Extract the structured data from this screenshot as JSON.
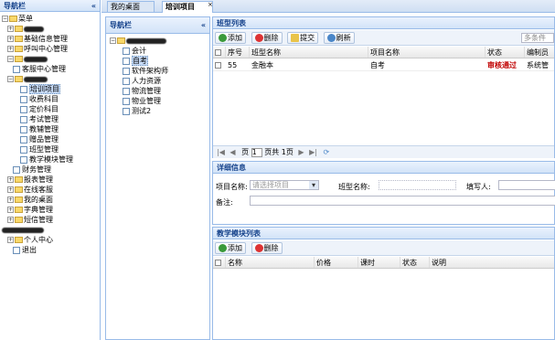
{
  "nav": {
    "title": "导航栏",
    "collapse": "«"
  },
  "tree": [
    {
      "label": "菜单",
      "level": 0,
      "pm": "−",
      "type": "folder"
    },
    {
      "label": "",
      "level": 1,
      "pm": "+",
      "type": "folder",
      "blur": 22
    },
    {
      "label": "基础信息管理",
      "level": 1,
      "pm": "+",
      "type": "folder"
    },
    {
      "label": "呼叫中心管理",
      "level": 1,
      "pm": "+",
      "type": "folder"
    },
    {
      "label": "",
      "level": 1,
      "pm": "−",
      "type": "folder",
      "blur": 26
    },
    {
      "label": "客服中心管理",
      "level": 2,
      "pm": "",
      "type": "leaf"
    },
    {
      "label": "",
      "level": 1,
      "pm": "−",
      "type": "folder",
      "blur": 26
    },
    {
      "label": "培训项目",
      "level": 3,
      "pm": "",
      "type": "leaf",
      "sel": true
    },
    {
      "label": "收费科目",
      "level": 3,
      "pm": "",
      "type": "leaf"
    },
    {
      "label": "定价科目",
      "level": 3,
      "pm": "",
      "type": "leaf"
    },
    {
      "label": "考试管理",
      "level": 3,
      "pm": "",
      "type": "leaf"
    },
    {
      "label": "教辅管理",
      "level": 3,
      "pm": "",
      "type": "leaf"
    },
    {
      "label": "赠品管理",
      "level": 3,
      "pm": "",
      "type": "leaf"
    },
    {
      "label": "班型管理",
      "level": 3,
      "pm": "",
      "type": "leaf"
    },
    {
      "label": "教学模块管理",
      "level": 3,
      "pm": "",
      "type": "leaf"
    },
    {
      "label": "财务管理",
      "level": 2,
      "pm": "",
      "type": "leaf"
    },
    {
      "label": "报表管理",
      "level": 1,
      "pm": "+",
      "type": "folder"
    },
    {
      "label": "在线客服",
      "level": 1,
      "pm": "+",
      "type": "folder"
    },
    {
      "label": "我的桌面",
      "level": 1,
      "pm": "+",
      "type": "folder"
    },
    {
      "label": "字典管理",
      "level": 1,
      "pm": "+",
      "type": "folder"
    },
    {
      "label": "短信管理",
      "level": 1,
      "pm": "+",
      "type": "folder"
    },
    {
      "label": "",
      "level": 0,
      "pm": "",
      "type": "blurline",
      "blur": 46
    },
    {
      "label": "个人中心",
      "level": 1,
      "pm": "+",
      "type": "folder"
    },
    {
      "label": "退出",
      "level": 2,
      "pm": "",
      "type": "leaf"
    }
  ],
  "tabs": [
    {
      "label": "我的桌面",
      "active": false
    },
    {
      "label": "培训项目",
      "active": true,
      "close": "×"
    }
  ],
  "subnav": {
    "title": "导航栏",
    "collapse": "«",
    "items": [
      "会计",
      "自考",
      "软件架构师",
      "人力资源",
      "物流管理",
      "物业管理",
      "测试2"
    ]
  },
  "classlist": {
    "title": "班型列表",
    "add": "添加",
    "del": "删除",
    "submit": "提交",
    "refresh": "刷新",
    "filter": "多条件",
    "cols": [
      "序号",
      "班型名称",
      "项目名称",
      "状态",
      "编制员"
    ],
    "rows": [
      {
        "no": "55",
        "name": "金融本",
        "project": "自考",
        "status": "审核通过",
        "editor": "系统管"
      }
    ]
  },
  "pager": {
    "page": "页",
    "page_num": "1",
    "total": "页共 1页"
  },
  "detail": {
    "title": "详细信息",
    "project_label": "项目名称:",
    "project_placeholder": "请选择项目",
    "class_label": "班型名称:",
    "writer_label": "填写人:",
    "remark_label": "备注:"
  },
  "modules": {
    "title": "教学模块列表",
    "add": "添加",
    "del": "删除",
    "cols": [
      "名称",
      "价格",
      "课时",
      "状态",
      "说明"
    ]
  },
  "colors": {
    "accent": "#15428b",
    "status_ok": "#c00000"
  }
}
